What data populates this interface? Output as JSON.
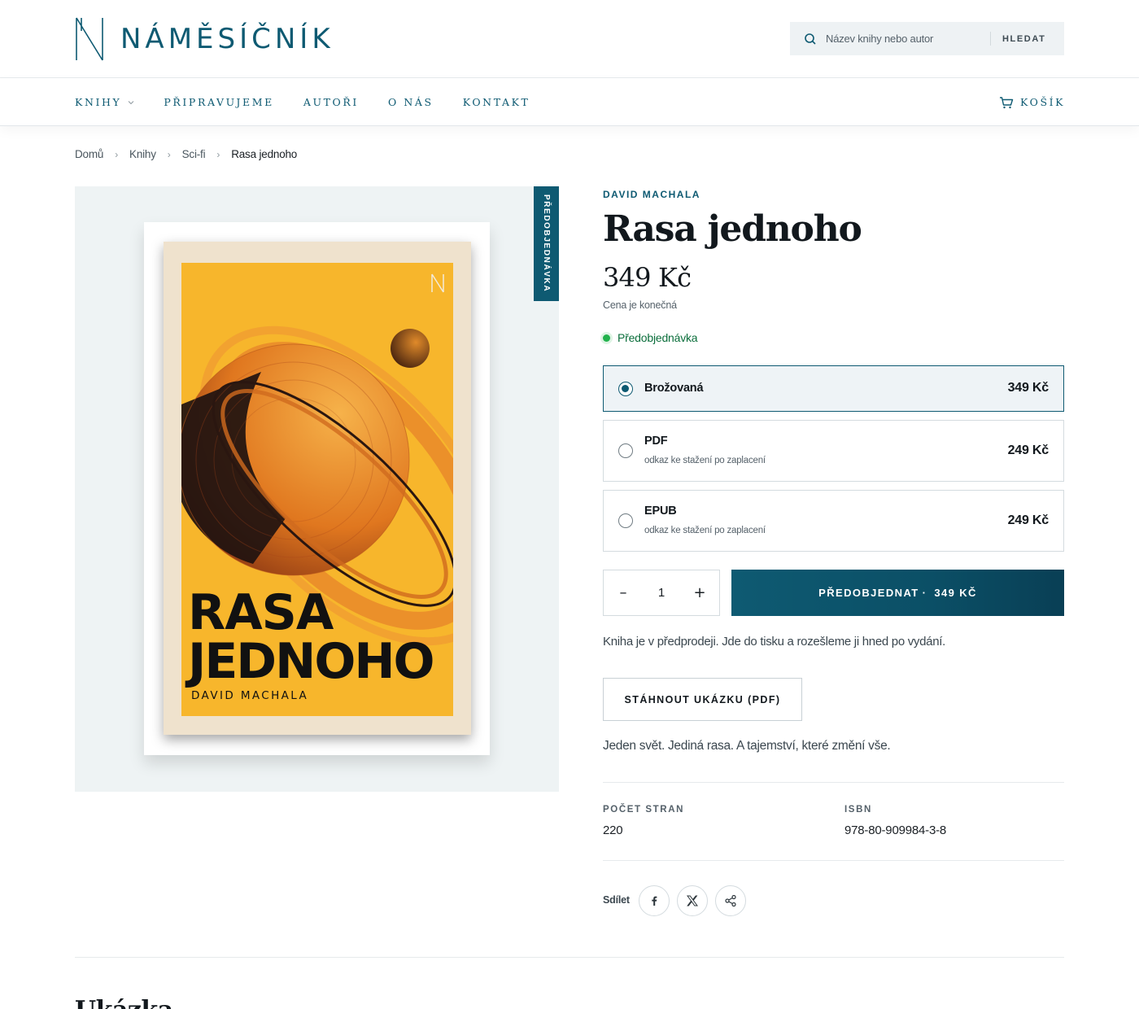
{
  "brand": {
    "name": "NÁMĚSÍČNÍK",
    "accent": "#0e5a72"
  },
  "search": {
    "placeholder": "Název knihy nebo autor",
    "button": "HLEDAT"
  },
  "nav": {
    "items": [
      {
        "label": "KNIHY",
        "dropdown": true
      },
      {
        "label": "PŘIPRAVUJEME"
      },
      {
        "label": "AUTOŘI"
      },
      {
        "label": "O NÁS"
      },
      {
        "label": "KONTAKT"
      }
    ],
    "cart": "KOŠÍK"
  },
  "breadcrumb": [
    "Domů",
    "Knihy",
    "Sci-fi",
    "Rasa jednoho"
  ],
  "cover": {
    "ribbon": "PŘEDOBJEDNÁVKA",
    "title_line1": "RASA",
    "title_line2": "JEDNOHO",
    "author": "DAVID MACHALA"
  },
  "product": {
    "author": "DAVID MACHALA",
    "title": "Rasa jednoho",
    "price": "349 Kč",
    "price_note": "Cena je konečná",
    "availability": "Předobjednávka",
    "formats": [
      {
        "name": "Brožovaná",
        "sub": "",
        "price": "349 Kč",
        "selected": true
      },
      {
        "name": "PDF",
        "sub": "odkaz ke stažení po zaplacení",
        "price": "249 Kč",
        "selected": false
      },
      {
        "name": "EPUB",
        "sub": "odkaz ke stažení po zaplacení",
        "price": "249 Kč",
        "selected": false
      }
    ],
    "quantity": "1",
    "qty_minus": "–",
    "qty_plus": "+",
    "buy_label": "PŘEDOBJEDNAT",
    "buy_dot": "·",
    "buy_price": "349 KČ",
    "preorder_text": "Kniha je v předprodeji. Jde do tisku a rozešleme ji hned po vydání.",
    "sample_label": "STÁHNOUT UKÁZKU (PDF)",
    "tagline": "Jeden svět. Jediná rasa. A tajemství, které změní vše.",
    "specs": [
      {
        "label": "POČET STRAN",
        "value": "220"
      },
      {
        "label": "ISBN",
        "value": "978-80-909984-3-8"
      }
    ],
    "share_label": "Sdílet",
    "share_buttons": [
      "facebook-icon",
      "x-icon",
      "share-icon"
    ]
  },
  "section_heading": "Ukázka"
}
